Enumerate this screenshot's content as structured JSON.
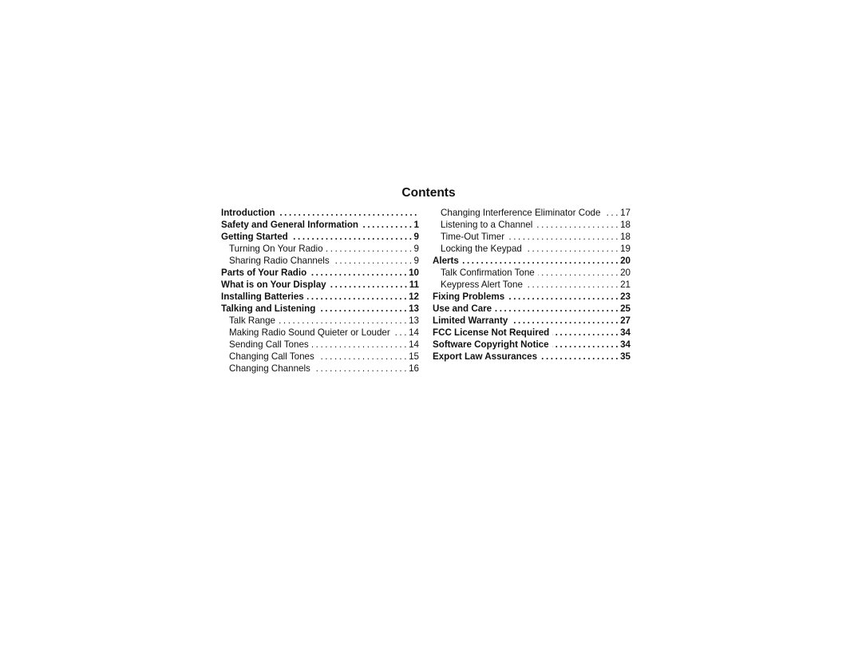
{
  "title": "Contents",
  "left_column": [
    {
      "label": "Introduction",
      "page": "",
      "level": "major"
    },
    {
      "label": "Safety and General Information",
      "page": "1",
      "level": "major"
    },
    {
      "label": "Getting Started",
      "page": "9",
      "level": "major"
    },
    {
      "label": "Turning On Your Radio",
      "page": "9",
      "level": "minor"
    },
    {
      "label": "Sharing Radio Channels",
      "page": "9",
      "level": "minor"
    },
    {
      "label": "Parts of Your Radio",
      "page": "10",
      "level": "major"
    },
    {
      "label": "What is on Your Display",
      "page": "11",
      "level": "major"
    },
    {
      "label": "Installing Batteries",
      "page": "12",
      "level": "major"
    },
    {
      "label": "Talking and Listening",
      "page": "13",
      "level": "major"
    },
    {
      "label": "Talk Range",
      "page": "13",
      "level": "minor"
    },
    {
      "label": "Making Radio Sound Quieter or Louder",
      "page": "14",
      "level": "minor"
    },
    {
      "label": "Sending Call Tones",
      "page": "14",
      "level": "minor"
    },
    {
      "label": "Changing Call Tones",
      "page": "15",
      "level": "minor"
    },
    {
      "label": "Changing Channels",
      "page": "16",
      "level": "minor"
    }
  ],
  "right_column": [
    {
      "label": "Changing Interference Eliminator Code",
      "page": "17",
      "level": "minor"
    },
    {
      "label": "Listening to a Channel",
      "page": "18",
      "level": "minor"
    },
    {
      "label": "Time-Out Timer",
      "page": "18",
      "level": "minor"
    },
    {
      "label": "Locking the Keypad",
      "page": "19",
      "level": "minor"
    },
    {
      "label": "Alerts",
      "page": "20",
      "level": "major"
    },
    {
      "label": "Talk Confirmation Tone",
      "page": "20",
      "level": "minor"
    },
    {
      "label": "Keypress Alert Tone",
      "page": "21",
      "level": "minor"
    },
    {
      "label": "Fixing Problems",
      "page": "23",
      "level": "major"
    },
    {
      "label": "Use and Care",
      "page": "25",
      "level": "major"
    },
    {
      "label": "Limited Warranty",
      "page": "27",
      "level": "major"
    },
    {
      "label": "FCC License Not Required",
      "page": "34",
      "level": "major"
    },
    {
      "label": "Software Copyright Notice",
      "page": "34",
      "level": "major"
    },
    {
      "label": "Export Law Assurances",
      "page": "35",
      "level": "major"
    }
  ],
  "leader_char": "."
}
